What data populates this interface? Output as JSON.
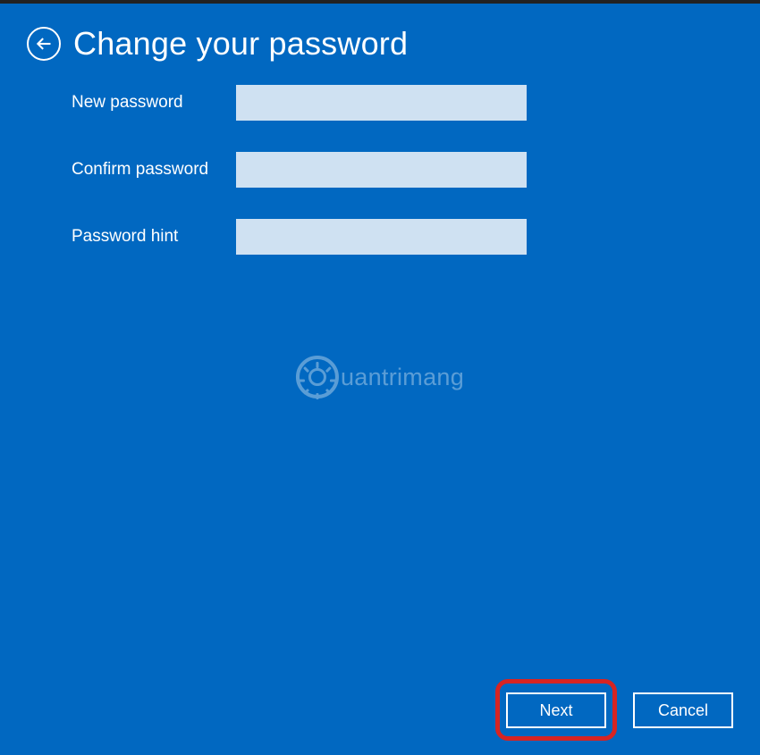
{
  "header": {
    "title": "Change your password"
  },
  "form": {
    "new_password": {
      "label": "New password",
      "value": ""
    },
    "confirm_password": {
      "label": "Confirm password",
      "value": ""
    },
    "password_hint": {
      "label": "Password hint",
      "value": ""
    }
  },
  "watermark": {
    "text": "uantrimang"
  },
  "buttons": {
    "next": "Next",
    "cancel": "Cancel"
  }
}
